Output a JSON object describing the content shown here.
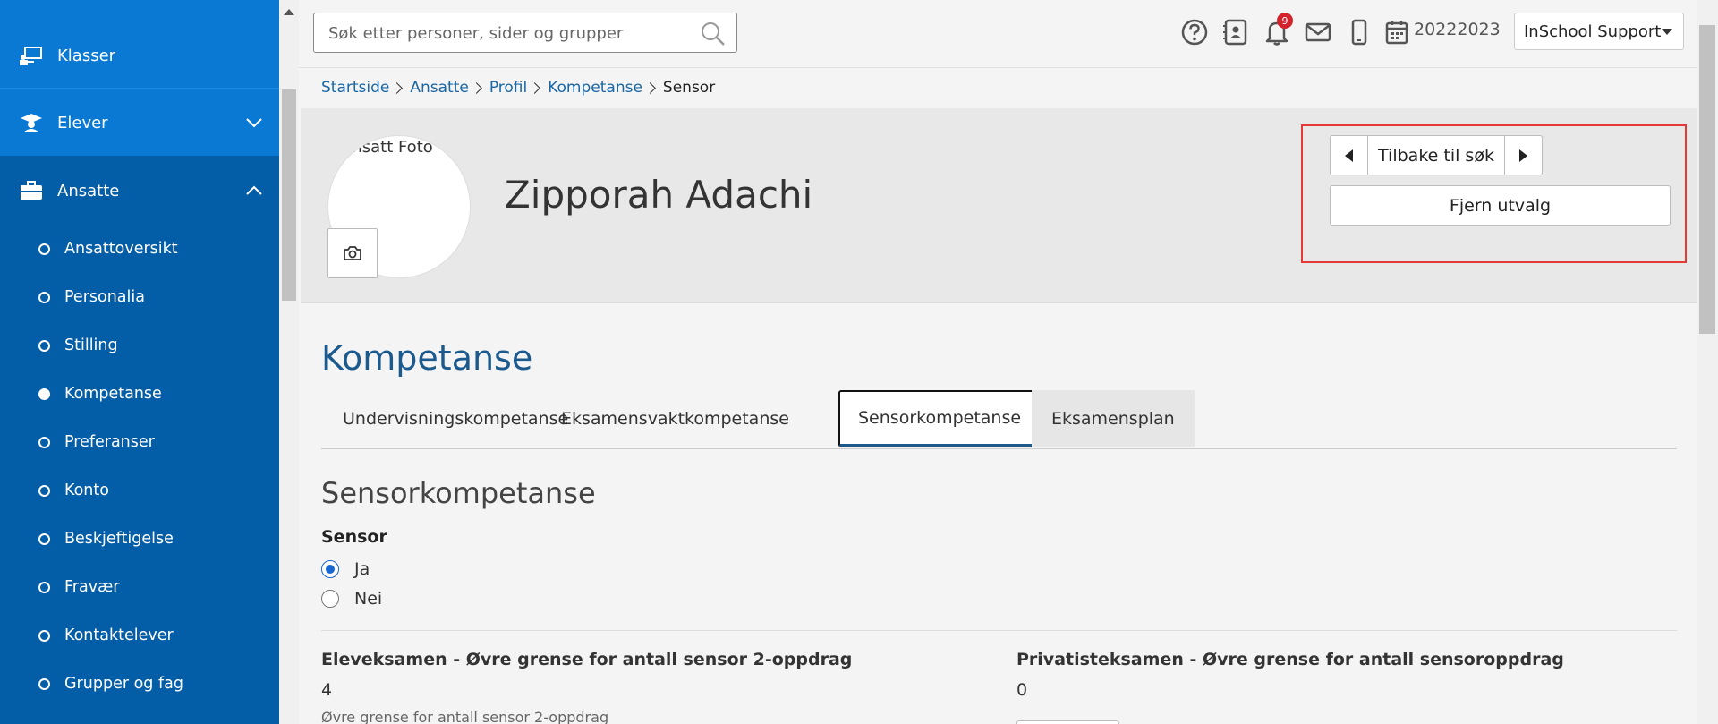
{
  "sidebar": {
    "klasser": "Klasser",
    "elever": "Elever",
    "ansatte": "Ansatte",
    "sub_items": [
      {
        "label": "Ansattoversikt",
        "active": false
      },
      {
        "label": "Personalia",
        "active": false
      },
      {
        "label": "Stilling",
        "active": false
      },
      {
        "label": "Kompetanse",
        "active": true
      },
      {
        "label": "Preferanser",
        "active": false
      },
      {
        "label": "Konto",
        "active": false
      },
      {
        "label": "Beskjeftigelse",
        "active": false
      },
      {
        "label": "Fravær",
        "active": false
      },
      {
        "label": "Kontaktelever",
        "active": false
      },
      {
        "label": "Grupper og fag",
        "active": false
      }
    ]
  },
  "topbar": {
    "search_placeholder": "Søk etter personer, sider og grupper",
    "notification_count": "9",
    "school_year": "20222023",
    "user_menu": "InSchool Support"
  },
  "breadcrumb": {
    "items": [
      "Startside",
      "Ansatte",
      "Profil",
      "Kompetanse"
    ],
    "current": "Sensor"
  },
  "profile": {
    "photo_alt": "Ansatt Foto",
    "name": "Zipporah Adachi",
    "back_to_search": "Tilbake til søk",
    "remove_selection": "Fjern utvalg"
  },
  "main": {
    "heading": "Kompetanse",
    "tabs": [
      {
        "label": "Undervisningskompetanse"
      },
      {
        "label": "Eksamensvaktkompetanse"
      },
      {
        "label": "Sensorkompetanse"
      },
      {
        "label": "Eksamensplan"
      }
    ],
    "active_tab": "Sensorkompetanse",
    "section_heading": "Sensorkompetanse",
    "sensor_label": "Sensor",
    "radio_yes": "Ja",
    "radio_no": "Nei",
    "sensor_selected": "Ja",
    "field1_label": "Eleveksamen - Øvre grense for antall sensor 2-oppdrag",
    "field1_value": "4",
    "field1_hint": "Øvre grense for antall sensor 2-oppdrag",
    "field2_label": "Privatisteksamen - Øvre grense for antall sensoroppdrag",
    "field2_value": "0"
  },
  "colors": {
    "sidebar_dark": "#045ea7",
    "sidebar_light": "#0a79d4",
    "link": "#1967a6",
    "heading": "#1c5a8e",
    "highlight_box": "#e53935",
    "badge": "#d3232d"
  }
}
